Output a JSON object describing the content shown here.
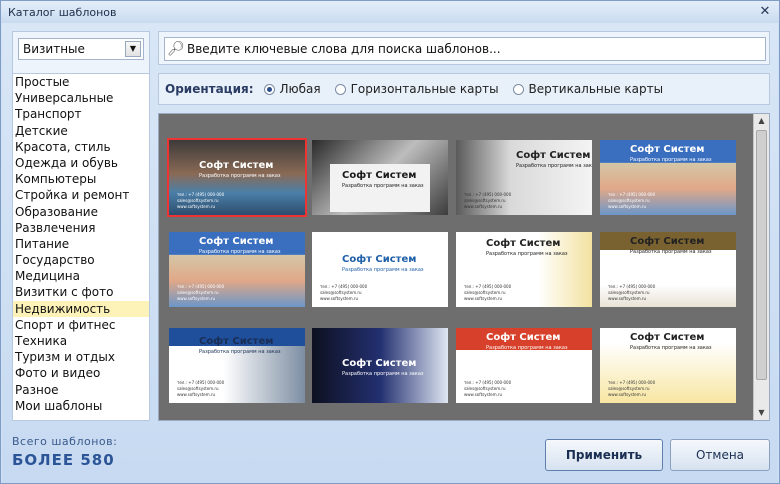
{
  "window": {
    "title": "Каталог шаблонов",
    "close_symbol": "✕"
  },
  "category_select": {
    "value": "Визитные",
    "arrow": "▼"
  },
  "search": {
    "text": "Введите ключевые слова для поиска шаблонов..."
  },
  "categories": [
    "Простые",
    "Универсальные",
    "Транспорт",
    "Детские",
    "Красота, стиль",
    "Одежда и обувь",
    "Компьютеры",
    "Стройка и ремонт",
    "Образование",
    "Развлечения",
    "Питание",
    "Государство",
    "Медицина",
    "Визитки с фото",
    "Недвижимость",
    "Спорт и фитнес",
    "Техника",
    "Туризм и отдых",
    "Фото и видео",
    "Разное",
    "Мои шаблоны"
  ],
  "selected_category_index": 14,
  "orientation": {
    "label": "Ориентация:",
    "options": [
      "Любая",
      "Горизонтальные карты",
      "Вертикальные карты"
    ],
    "selected_index": 0
  },
  "cards": {
    "brand": "Софт Систем",
    "tagline": "Разработка программ на заказ",
    "person": "Михаил Сафронов",
    "person_role": "менеджер по продажам",
    "phone": "тел.: +7 (495) 000-000",
    "email": "sales@softsystem.ru",
    "site": "www.softsystem.ru",
    "selected_index": 0
  },
  "footer": {
    "total_label": "Всего шаблонов:",
    "total_count": "БОЛЕЕ 580"
  },
  "buttons": {
    "apply": "Применить",
    "cancel": "Отмена"
  },
  "colors": {
    "accent": "#2b5597",
    "selected_category": "#fdf3b8",
    "gallery_bg": "#6e6e6e",
    "selection_outline": "#e33333"
  }
}
